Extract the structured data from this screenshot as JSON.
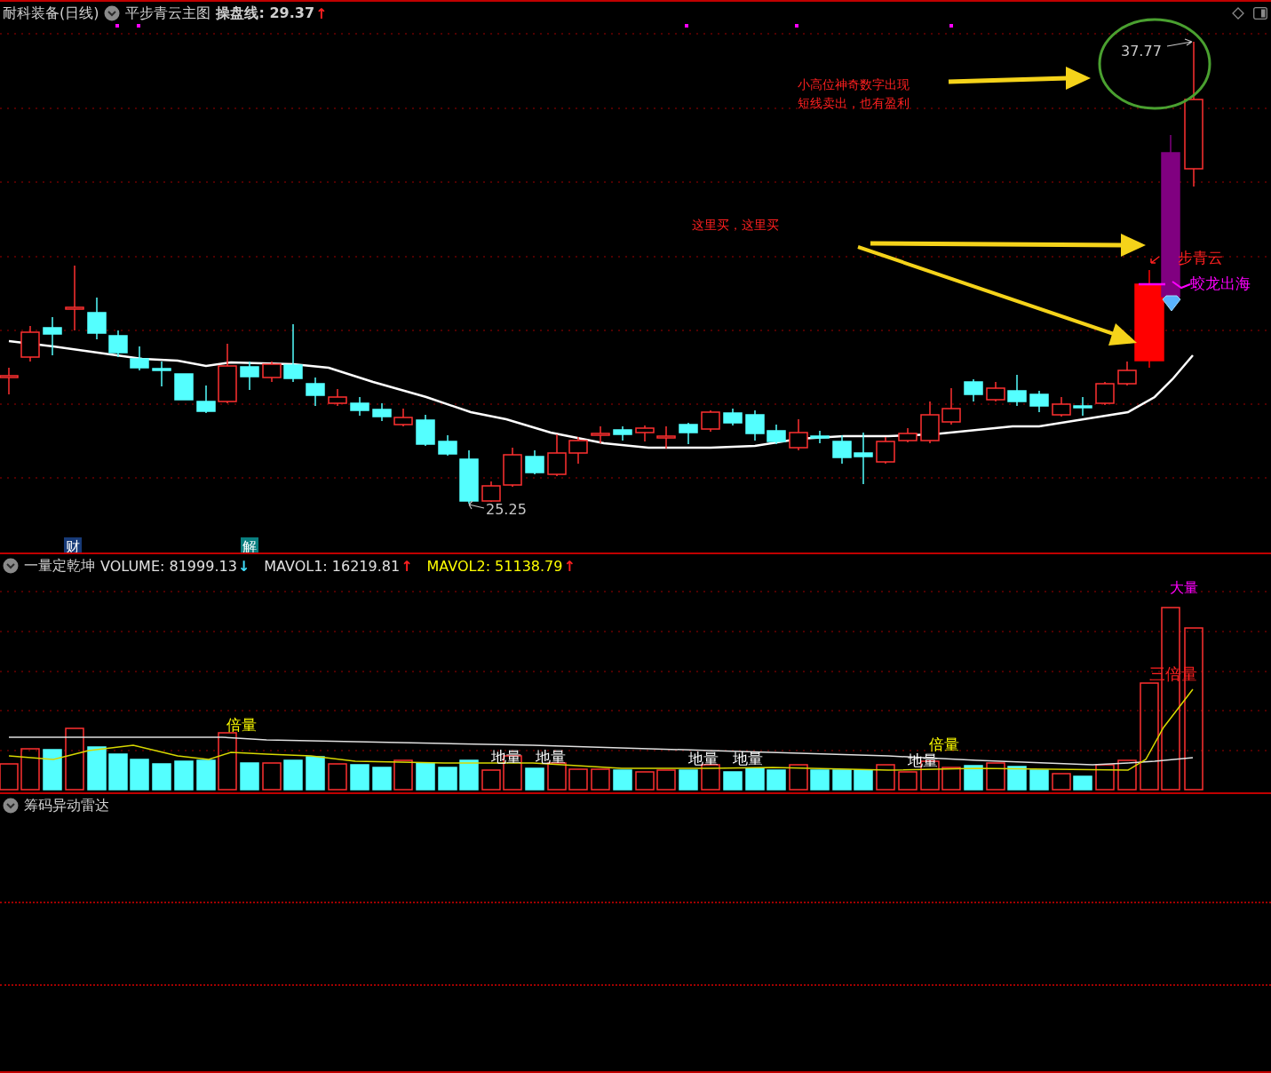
{
  "header": {
    "title": "耐科装备(日线)",
    "indicator": "平步青云主图",
    "readout": {
      "text": "操盘线: 29.37",
      "arrow": {
        "text": "↑",
        "color": "#ff2020"
      }
    }
  },
  "price_chart": {
    "labels": [
      {
        "text": "37.77",
        "color": "#c8c8c8"
      },
      {
        "text": "25.25",
        "color": "#c8c8c8"
      },
      {
        "text": "小高位神奇数字出现",
        "color": "#ff2020"
      },
      {
        "text": "短线卖出，也有盈利",
        "color": "#ff2020"
      },
      {
        "text": "这里买，这里买",
        "color": "#ff2020"
      },
      {
        "text": "步青云",
        "color": "#ff2020"
      },
      {
        "text": "蛟龙出海",
        "color": "#ff00ff"
      }
    ],
    "badges": [
      {
        "text": "财",
        "color": "#173a78"
      },
      {
        "text": "解",
        "color": "#0a7f80"
      }
    ]
  },
  "volume_panel": {
    "title": "一量定乾坤",
    "readouts": [
      {
        "text": "VOLUME: 81999.13",
        "arrow": {
          "text": "↓",
          "color": "#40e0ff"
        },
        "color": "#e0e0e0"
      },
      {
        "text": "MAVOL1: 16219.81",
        "arrow": {
          "text": "↑",
          "color": "#ff2020"
        },
        "color": "#e0e0e0"
      },
      {
        "text": "MAVOL2: 51138.79",
        "arrow": {
          "text": "↑",
          "color": "#ff2020"
        },
        "color": "#ffff00"
      }
    ],
    "labels": [
      {
        "text": "倍量",
        "color": "#ffff00"
      },
      {
        "text": "地量",
        "color": "#ffffff"
      },
      {
        "text": "地量",
        "color": "#ffffff"
      },
      {
        "text": "地量",
        "color": "#ffffff"
      },
      {
        "text": "地量",
        "color": "#ffffff"
      },
      {
        "text": "倍量",
        "color": "#ffff00"
      },
      {
        "text": "地量",
        "color": "#ffffff"
      },
      {
        "text": "三倍量",
        "color": "#ff2020"
      },
      {
        "text": "大量",
        "color": "#ff00ff"
      }
    ]
  },
  "chip_panel": {
    "title": "筹码异动雷达"
  }
}
